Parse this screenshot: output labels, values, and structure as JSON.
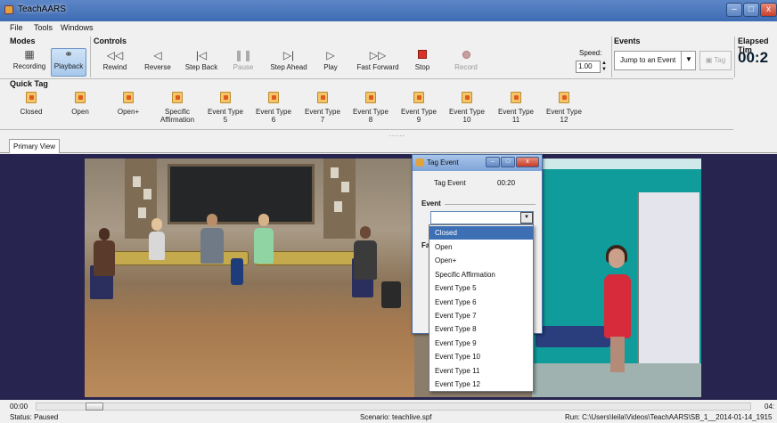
{
  "window": {
    "title": "TeachAARS"
  },
  "menu": {
    "file": "File",
    "tools": "Tools",
    "windows": "Windows"
  },
  "modes": {
    "label": "Modes",
    "recording": "Recording",
    "playback": "Playback",
    "active": "playback"
  },
  "controls": {
    "label": "Controls",
    "rewind": "Rewind",
    "reverse": "Reverse",
    "step_back": "Step Back",
    "pause": "Pause",
    "step_ahead": "Step Ahead",
    "play": "Play",
    "fast_forward": "Fast Forward",
    "stop": "Stop",
    "record": "Record",
    "disabled": [
      "pause",
      "record"
    ]
  },
  "speed": {
    "label": "Speed:",
    "value": "1.00"
  },
  "events": {
    "label": "Events",
    "jump_select": "Jump to an Event",
    "tag_button": "Tag"
  },
  "elapsed": {
    "label": "Elapsed Tim",
    "value": "00:2"
  },
  "quick_tag": {
    "label": "Quick Tag",
    "items": [
      {
        "line1": "Closed",
        "line2": ""
      },
      {
        "line1": "Open",
        "line2": ""
      },
      {
        "line1": "Open+",
        "line2": ""
      },
      {
        "line1": "Specific",
        "line2": "Affirmation"
      },
      {
        "line1": "Event Type",
        "line2": "5"
      },
      {
        "line1": "Event Type",
        "line2": "6"
      },
      {
        "line1": "Event Type",
        "line2": "7"
      },
      {
        "line1": "Event Type",
        "line2": "8"
      },
      {
        "line1": "Event Type",
        "line2": "9"
      },
      {
        "line1": "Event Type",
        "line2": "10"
      },
      {
        "line1": "Event Type",
        "line2": "11"
      },
      {
        "line1": "Event Type",
        "line2": "12"
      }
    ]
  },
  "view": {
    "tab": "Primary View"
  },
  "tag_dialog": {
    "title": "Tag Event",
    "label": "Tag Event",
    "time": "00:20",
    "event_group": "Event",
    "second_group": "Fa",
    "options": [
      "Closed",
      "Open",
      "Open+",
      "Specific Affirmation",
      "Event Type 5",
      "Event Type 6",
      "Event Type 7",
      "Event Type 8",
      "Event Type 9",
      "Event Type 10",
      "Event Type 11",
      "Event Type 12"
    ],
    "highlighted": "Closed"
  },
  "timeline": {
    "start": "00:00",
    "end": "04:"
  },
  "status": {
    "state": "Status: Paused",
    "scenario": "Scenario: teachlive.spf",
    "run": "Run: C:\\Users\\leila\\Videos\\TeachAARS\\SB_1__2014-01-14_1915"
  },
  "colors": {
    "titlebar": "#4a78bd",
    "viewport_bg": "#27254f",
    "dropdown_highlight": "#3d6fb5",
    "video_wall": "#0f9c9a"
  }
}
